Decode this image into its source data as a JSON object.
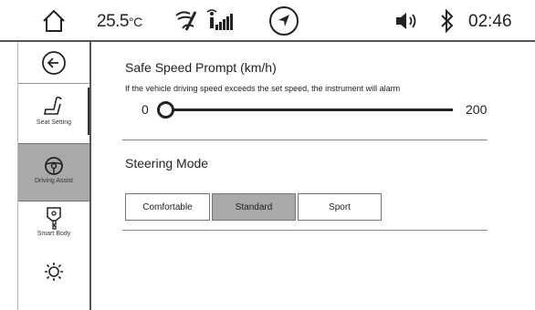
{
  "status_bar": {
    "temperature": "25.5",
    "temperature_unit": "°C",
    "clock": "02:46",
    "icons": [
      "home-icon",
      "fan-icon",
      "signal-icon",
      "navigation-icon",
      "volume-icon",
      "bluetooth-icon"
    ]
  },
  "sidebar": {
    "items": [
      {
        "icon": "back-arrow-icon",
        "label": ""
      },
      {
        "icon": "seat-icon",
        "label": "Seat Setting"
      },
      {
        "icon": "steering-wheel-icon",
        "label": "Driving Assist",
        "selected": true
      },
      {
        "icon": "key-icon",
        "label": "Smart Body"
      },
      {
        "icon": "light-icon",
        "label": ""
      }
    ]
  },
  "safe_speed": {
    "title": "Safe Speed Prompt (km/h)",
    "description": "If the vehicle driving speed exceeds the set speed, the instrument will alarm",
    "min_label": "0",
    "max_label": "200",
    "value": 0
  },
  "steering_mode": {
    "title": "Steering Mode",
    "options": [
      "Comfortable",
      "Standard",
      "Sport"
    ],
    "selected": "Standard"
  },
  "colors": {
    "selected_bg": "#a9a9a9",
    "line": "#555555"
  }
}
